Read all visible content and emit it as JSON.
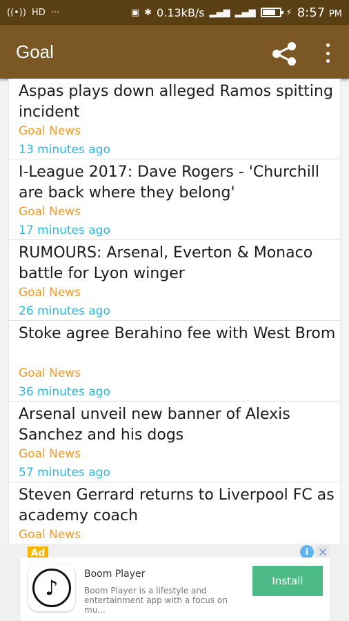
{
  "status_bar": {
    "left_icons": [
      "wireless-broadcast-icon",
      "hd-icon",
      "more-icon"
    ],
    "left_glyphs": [
      "((•))",
      "HD",
      "···"
    ],
    "speed": "0.13kB/s",
    "time": "8:57",
    "time_suffix": "PM"
  },
  "app_bar": {
    "title": "Goal",
    "background": "#7a5724"
  },
  "feed": {
    "items": [
      {
        "title": "Aspas plays down alleged Ramos spitting incident",
        "source": "Goal News",
        "time": "13 minutes ago"
      },
      {
        "title": "I-League 2017: Dave Rogers - 'Churchill are back where they belong'",
        "source": "Goal News",
        "time": "17 minutes ago"
      },
      {
        "title": "RUMOURS: Arsenal, Everton & Monaco battle for Lyon winger",
        "source": "Goal News",
        "time": "26 minutes ago"
      },
      {
        "title": "Stoke agree Berahino fee with West Brom",
        "source": "Goal News",
        "time": "36 minutes ago"
      },
      {
        "title": "Arsenal unveil new banner of Alexis Sanchez and his dogs",
        "source": "Goal News",
        "time": "57 minutes ago"
      },
      {
        "title": "Steven Gerrard returns to Liverpool FC as academy coach",
        "source": "Goal News",
        "time": ""
      }
    ],
    "source_color": "#f39a1e",
    "time_color": "#29b8e0"
  },
  "ad": {
    "badge": "Ad",
    "app_name": "Boom Player",
    "description": "Boom Player is a lifestyle and entertainment app with a focus on mu...",
    "install_label": "Install",
    "icon_glyph": "♪",
    "info_glyph": "i",
    "close_glyph": "✕"
  }
}
